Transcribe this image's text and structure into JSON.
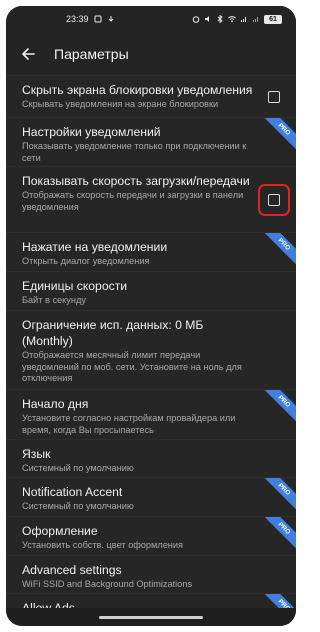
{
  "status_bar": {
    "time": "23:39",
    "battery": "61"
  },
  "app_bar": {
    "title": "Параметры"
  },
  "settings": [
    {
      "title": "Скрыть экрана блокировки уведомления",
      "subtitle": "Скрывать уведомления на экране блокировки",
      "pro": false,
      "checkbox": true,
      "checked": false
    },
    {
      "title": "Настройки уведомлений",
      "subtitle": "Показывать уведомление только при подключении к сети",
      "pro": true,
      "checkbox": false
    },
    {
      "title": "Показывать скорость загрузки/передачи",
      "subtitle": "Отображать скорость передачи и загрузки в панели уведомления",
      "pro": false,
      "checkbox": true,
      "checked": false,
      "highlighted": true
    },
    {
      "title": "Нажатие на уведомлении",
      "subtitle": "Открыть диалог уведомления",
      "pro": true,
      "checkbox": false
    },
    {
      "title": "Единицы скорости",
      "subtitle": "Байт в секунду",
      "pro": false,
      "checkbox": false
    },
    {
      "title": "Ограничение исп. данных: 0 МБ (Monthly)",
      "subtitle": "Отображается месячный лимит передачи уведомлений по моб. сети. Установите на ноль для отключения",
      "pro": false,
      "checkbox": false
    },
    {
      "title": "Начало дня",
      "subtitle": "Установите согласно настройкам провайдера или время, когда Вы просыпаетесь",
      "pro": true,
      "checkbox": false
    },
    {
      "title": "Язык",
      "subtitle": "Системный по умолчанию",
      "pro": false,
      "checkbox": false
    },
    {
      "title": "Notification Accent",
      "subtitle": "Системный по умолчанию",
      "pro": true,
      "checkbox": false
    },
    {
      "title": "Оформление",
      "subtitle": "Установить собств. цвет оформления",
      "pro": true,
      "checkbox": false
    },
    {
      "title": "Advanced settings",
      "subtitle": "WiFi SSID and Background Optimizations",
      "pro": false,
      "checkbox": false
    },
    {
      "title": "Allow Ads",
      "subtitle": "",
      "pro": true,
      "checkbox": false
    }
  ],
  "pro_label": "PRO",
  "colors": {
    "background": "#262626",
    "pro_badge": "#3f7fe0",
    "highlight": "#e02424"
  }
}
